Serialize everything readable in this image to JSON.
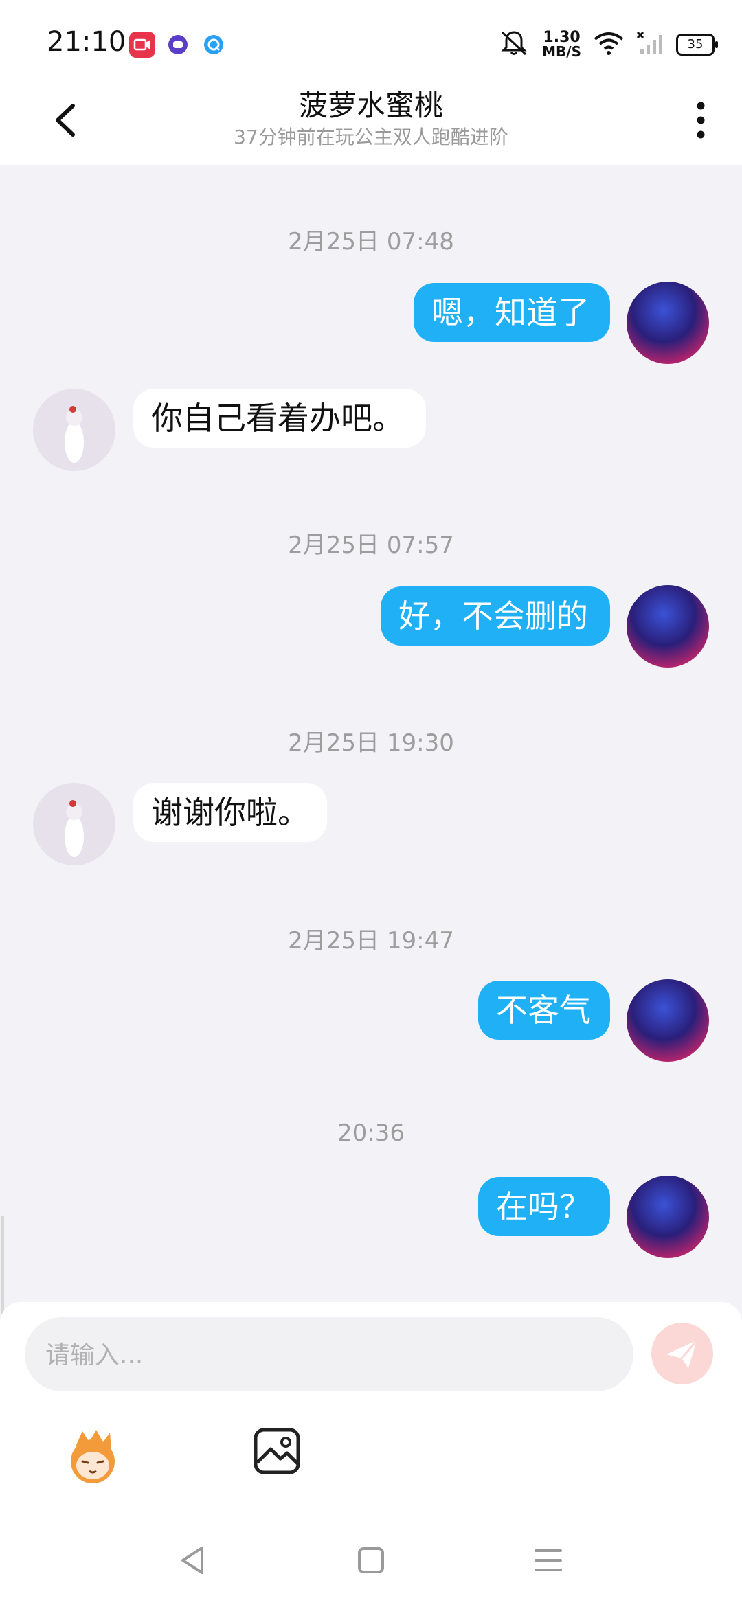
{
  "status_bar": {
    "time": "21:10",
    "net_speed_value": "1.30",
    "net_speed_unit": "MB/S",
    "battery": "35",
    "icons": [
      "video-recorder-icon",
      "app-notification-icon",
      "qq-browser-icon",
      "mute-bell-icon",
      "wifi-icon",
      "signal-icon",
      "battery-icon"
    ]
  },
  "header": {
    "title": "菠萝水蜜桃",
    "subtitle": "37分钟前在玩公主双人跑酷进阶"
  },
  "messages": [
    {
      "time": "2月25日 07:48"
    },
    {
      "sender": "me",
      "text": "嗯，知道了"
    },
    {
      "sender": "other",
      "text": "你自己看着办吧。"
    },
    {
      "time": "2月25日 07:57"
    },
    {
      "sender": "me",
      "text": "好，不会删的"
    },
    {
      "time": "2月25日 19:30"
    },
    {
      "sender": "other",
      "text": "谢谢你啦。"
    },
    {
      "time": "2月25日 19:47"
    },
    {
      "sender": "me",
      "text": "不客气"
    },
    {
      "time": "20:36"
    },
    {
      "sender": "me",
      "text": "在吗？"
    }
  ],
  "input": {
    "placeholder": "请输入...",
    "value": ""
  },
  "colors": {
    "my_bubble": "#1fb0f5",
    "other_bubble": "#ffffff",
    "background": "#f3f2f7",
    "send_button_disabled": "#fbd8d6"
  }
}
